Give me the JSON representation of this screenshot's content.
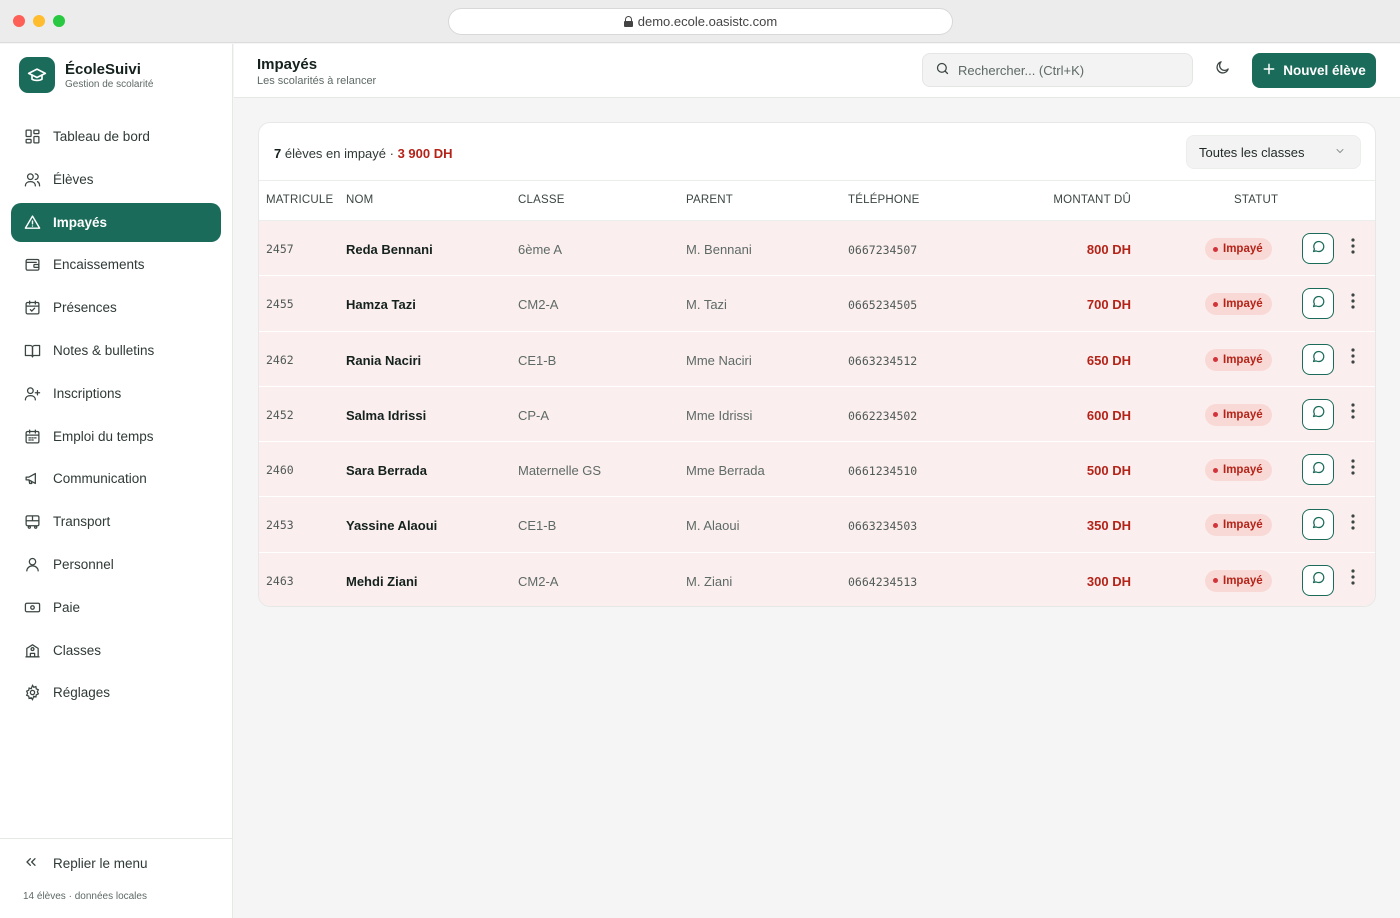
{
  "browser": {
    "url": "demo.ecole.oasistc.com"
  },
  "brand": {
    "name": "ÉcoleSuivi",
    "subtitle": "Gestion de scolarité"
  },
  "nav": [
    {
      "label": "Tableau de bord",
      "icon": "dashboard-icon",
      "active": false
    },
    {
      "label": "Élèves",
      "icon": "users-icon",
      "active": false
    },
    {
      "label": "Impayés",
      "icon": "alert-triangle-icon",
      "active": true
    },
    {
      "label": "Encaissements",
      "icon": "wallet-icon",
      "active": false
    },
    {
      "label": "Présences",
      "icon": "calendar-check-icon",
      "active": false
    },
    {
      "label": "Notes & bulletins",
      "icon": "book-open-icon",
      "active": false
    },
    {
      "label": "Inscriptions",
      "icon": "user-plus-icon",
      "active": false
    },
    {
      "label": "Emploi du temps",
      "icon": "calendar-icon",
      "active": false
    },
    {
      "label": "Communication",
      "icon": "megaphone-icon",
      "active": false
    },
    {
      "label": "Transport",
      "icon": "bus-icon",
      "active": false
    },
    {
      "label": "Personnel",
      "icon": "user-icon",
      "active": false
    },
    {
      "label": "Paie",
      "icon": "banknote-icon",
      "active": false
    },
    {
      "label": "Classes",
      "icon": "school-icon",
      "active": false
    },
    {
      "label": "Réglages",
      "icon": "gear-icon",
      "active": false
    }
  ],
  "sidebar_footer": {
    "collapse_label": "Replier le menu",
    "note": "14 élèves · données locales"
  },
  "header": {
    "title": "Impayés",
    "subtitle": "Les scolarités à relancer",
    "search_placeholder": "Rechercher...  (Ctrl+K)",
    "new_button": "Nouvel élève"
  },
  "summary": {
    "count_value": "7",
    "count_text": " élèves en impayé · ",
    "amount": "3 900 DH"
  },
  "filter": {
    "selected": "Toutes les classes"
  },
  "table": {
    "columns": [
      "MATRICULE",
      "NOM",
      "CLASSE",
      "PARENT",
      "TÉLÉPHONE",
      "MONTANT DÛ",
      "STATUT"
    ],
    "rows": [
      {
        "matricule": "2457",
        "nom": "Reda Bennani",
        "classe": "6ème A",
        "parent": "M. Bennani",
        "telephone": "0667234507",
        "montant": "800 DH",
        "statut": "Impayé"
      },
      {
        "matricule": "2455",
        "nom": "Hamza Tazi",
        "classe": "CM2-A",
        "parent": "M. Tazi",
        "telephone": "0665234505",
        "montant": "700 DH",
        "statut": "Impayé"
      },
      {
        "matricule": "2462",
        "nom": "Rania Naciri",
        "classe": "CE1-B",
        "parent": "Mme Naciri",
        "telephone": "0663234512",
        "montant": "650 DH",
        "statut": "Impayé"
      },
      {
        "matricule": "2452",
        "nom": "Salma Idrissi",
        "classe": "CP-A",
        "parent": "Mme Idrissi",
        "telephone": "0662234502",
        "montant": "600 DH",
        "statut": "Impayé"
      },
      {
        "matricule": "2460",
        "nom": "Sara Berrada",
        "classe": "Maternelle GS",
        "parent": "Mme Berrada",
        "telephone": "0661234510",
        "montant": "500 DH",
        "statut": "Impayé"
      },
      {
        "matricule": "2453",
        "nom": "Yassine Alaoui",
        "classe": "CE1-B",
        "parent": "M. Alaoui",
        "telephone": "0663234503",
        "montant": "350 DH",
        "statut": "Impayé"
      },
      {
        "matricule": "2463",
        "nom": "Mehdi Ziani",
        "classe": "CM2-A",
        "parent": "M. Ziani",
        "telephone": "0664234513",
        "montant": "300 DH",
        "statut": "Impayé"
      }
    ]
  },
  "colors": {
    "accent": "#1b6b5a",
    "danger": "#b42318",
    "row_bg": "#fbeeee",
    "badge_bg": "#f9d9d6"
  }
}
